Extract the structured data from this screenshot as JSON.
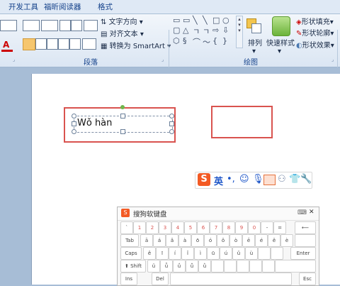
{
  "tabs": [
    "开发工具",
    "福昕阅读器",
    "格式"
  ],
  "ribbon": {
    "text_direction_label": "文字方向",
    "align_text_label": "对齐文本",
    "convert_smartart_label": "转换为 SmartArt",
    "arrange_label": "排列",
    "quick_styles_label": "快速样式",
    "shape_fill_label": "形状填充",
    "shape_outline_label": "形状轮廓",
    "shape_effects_label": "形状效果",
    "group_paragraph": "段落",
    "group_drawing": "绘图",
    "font_color_letter": "A"
  },
  "document": {
    "textbox_text": "Wǒ hàn"
  },
  "sogou": {
    "mode_label": "英",
    "punct_label": "•,"
  },
  "keyboard": {
    "title": "搜狗软键盘",
    "close_label": "✕",
    "rows": [
      [
        "`",
        "1",
        "2",
        "3",
        "4",
        "5",
        "6",
        "7",
        "8",
        "9",
        "0",
        "-",
        "=",
        "⟵"
      ],
      [
        "Tab",
        "ā",
        "á",
        "ǎ",
        "à",
        "ō",
        "ó",
        "ǒ",
        "ò",
        "ē",
        "é",
        "ě",
        "è"
      ],
      [
        "Caps",
        "ê",
        "ī",
        "í",
        "ǐ",
        "ì",
        "ū",
        "ú",
        "ǔ",
        "ù",
        "Enter"
      ],
      [
        "⬆ Shift",
        "ü",
        "ǖ",
        "ǘ",
        "ǚ",
        "ǜ",
        "",
        "",
        "",
        "",
        ""
      ],
      [
        "Ins",
        "Del",
        "Esc"
      ]
    ]
  },
  "colors": {
    "accent_red": "#d9534f",
    "ribbon_blue": "#15428b"
  }
}
